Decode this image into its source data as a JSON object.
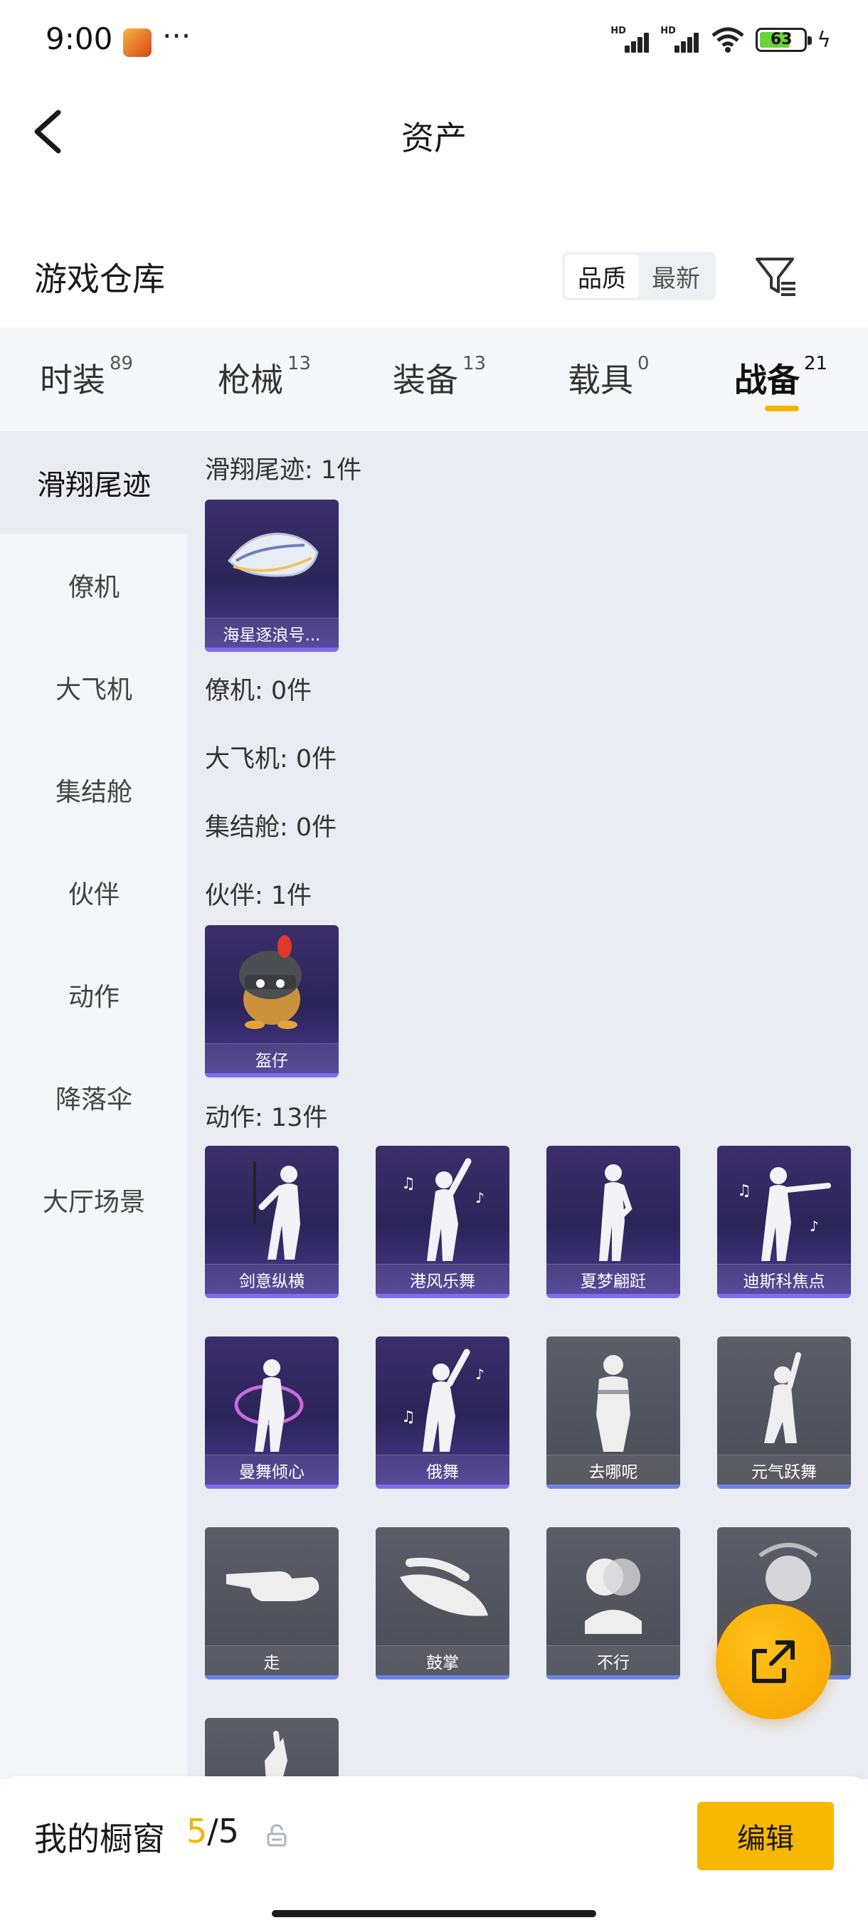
{
  "status_bar": {
    "time": "9:00",
    "dots": "···",
    "hd1": "HD",
    "hd2": "HD",
    "battery": "63"
  },
  "header": {
    "title": "资产"
  },
  "warehouse": {
    "title": "游戏仓库",
    "sort_quality": "品质",
    "sort_newest": "最新",
    "active_sort": "品质"
  },
  "tabs": [
    {
      "label": "时装",
      "count": "89"
    },
    {
      "label": "枪械",
      "count": "13"
    },
    {
      "label": "装备",
      "count": "13"
    },
    {
      "label": "载具",
      "count": "0"
    },
    {
      "label": "战备",
      "count": "21"
    }
  ],
  "active_tab": "战备",
  "sidenav": [
    "滑翔尾迹",
    "僚机",
    "大飞机",
    "集结舱",
    "伙伴",
    "动作",
    "降落伞",
    "大厅场景"
  ],
  "active_nav": "滑翔尾迹",
  "sections": {
    "glide_trail": {
      "label": "滑翔尾迹: 1件",
      "items": [
        "海星逐浪号..."
      ]
    },
    "wingman": {
      "label": "僚机: 0件"
    },
    "big_plane": {
      "label": "大飞机: 0件"
    },
    "assembly_pod": {
      "label": "集结舱: 0件"
    },
    "partner": {
      "label": "伙伴: 1件",
      "items": [
        "盔仔"
      ]
    },
    "emote": {
      "label": "动作: 13件",
      "items": [
        "剑意纵横",
        "港风乐舞",
        "夏梦翩跹",
        "迪斯科焦点",
        "曼舞倾心",
        "俄舞",
        "去哪呢",
        "元气跃舞",
        "走",
        "鼓掌",
        "不行",
        "",
        ""
      ]
    }
  },
  "showcase": {
    "label": "我的橱窗",
    "current": "5",
    "total": "/5"
  },
  "edit_button": "编辑",
  "colors": {
    "accent": "#f5b400",
    "purple_card": "#3b2f6b",
    "gray_card": "#4a4c56",
    "content_bg": "#e9ecf2"
  },
  "icons": [
    "back-arrow-icon",
    "filter-icon",
    "lock-icon",
    "share-icon"
  ]
}
